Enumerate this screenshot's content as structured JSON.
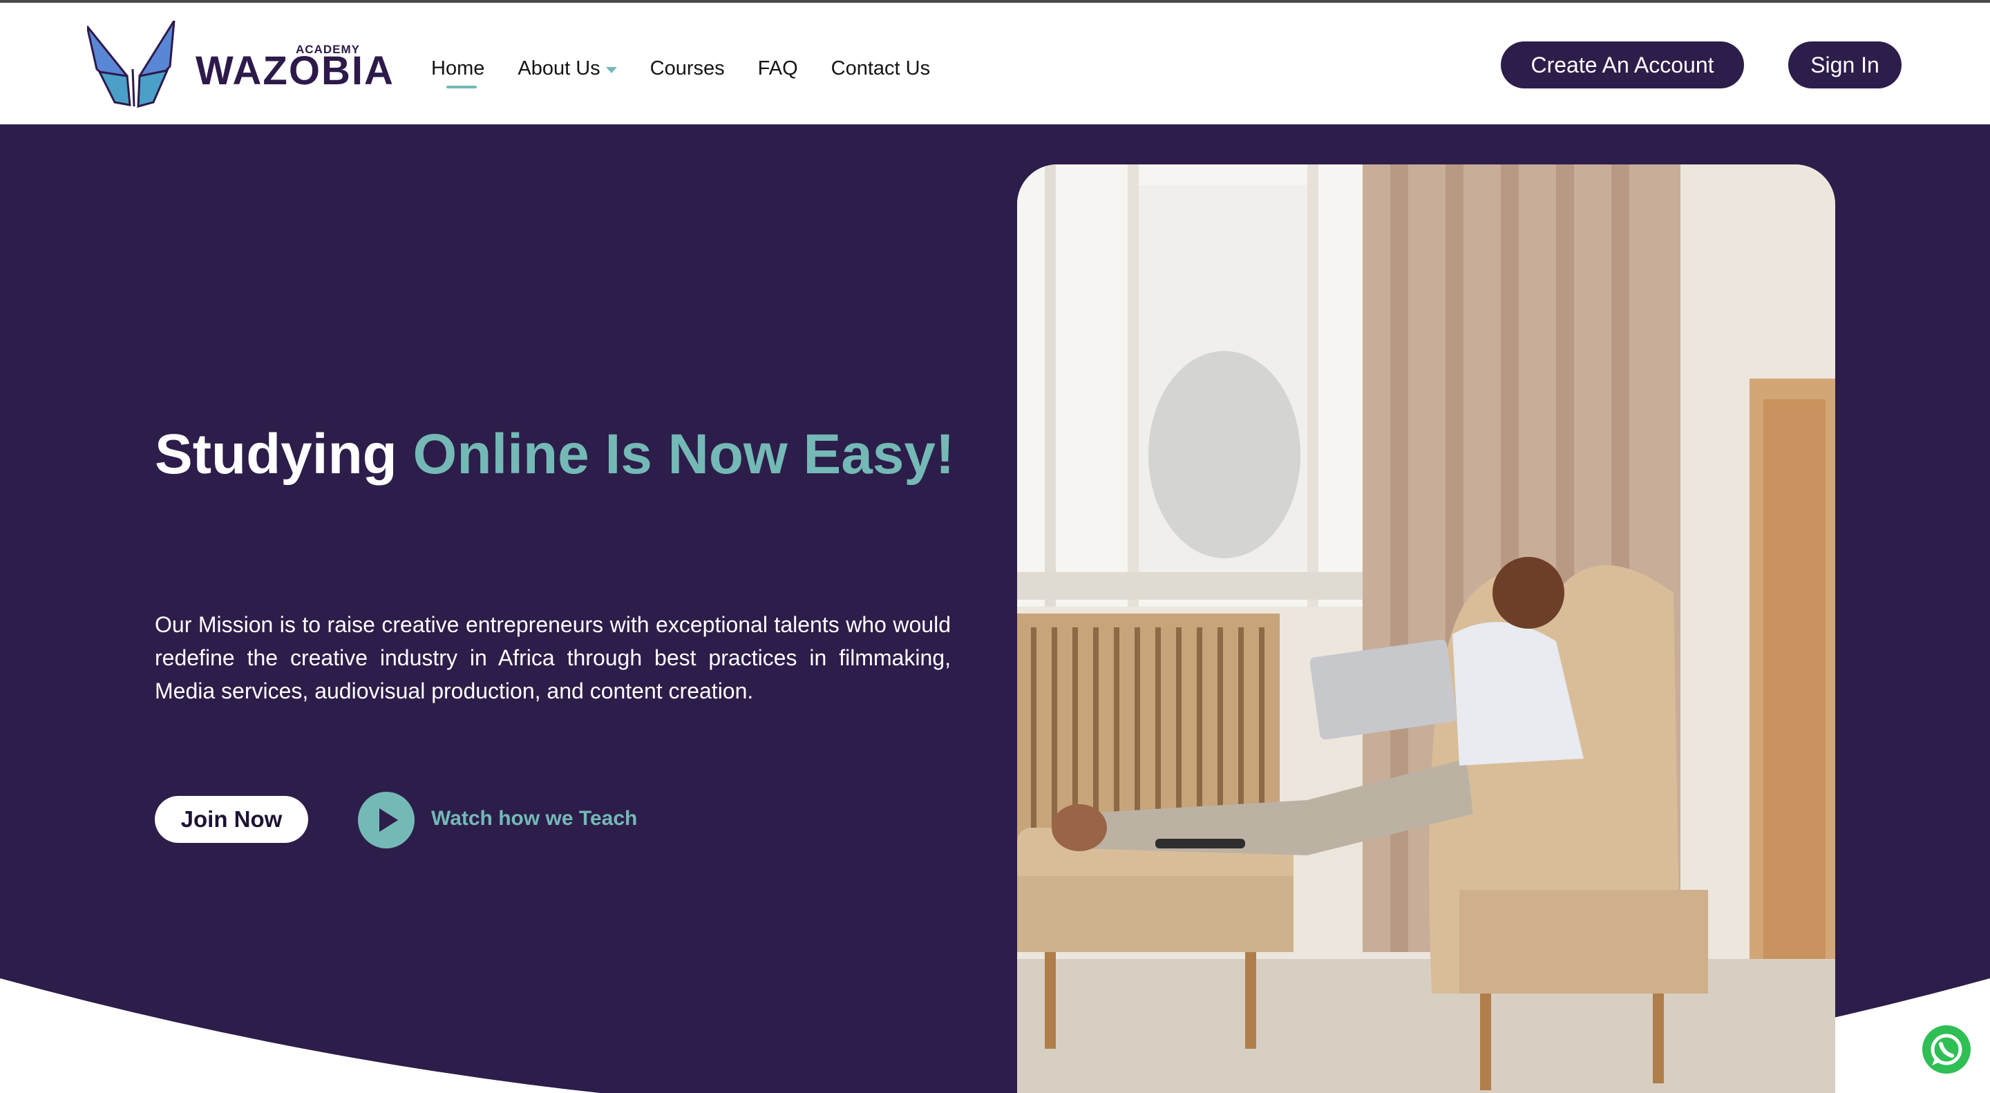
{
  "brand": {
    "name": "WAZOBIA",
    "tag": "ACADEMY"
  },
  "nav": [
    {
      "label": "Home",
      "active": true
    },
    {
      "label": "About Us",
      "dropdown": true
    },
    {
      "label": "Courses"
    },
    {
      "label": "FAQ"
    },
    {
      "label": "Contact Us"
    }
  ],
  "auth": {
    "create_account": "Create An Account",
    "sign_in": "Sign In"
  },
  "hero": {
    "headline_white": "Studying",
    "headline_accent": "Online Is Now Easy!",
    "mission": "Our Mission is to raise creative entrepreneurs with exceptional talents who would redefine the creative industry in Africa through best practices in filmmaking, Media services, audiovisual production, and content creation.",
    "join_label": "Join Now",
    "watch_label": "Watch how we Teach"
  },
  "colors": {
    "primary": "#2d1d4a",
    "accent": "#74b9b6",
    "white": "#ffffff"
  },
  "icons": {
    "play": "play-icon",
    "whatsapp": "whatsapp-icon",
    "dropdown": "chevron-down-icon"
  }
}
